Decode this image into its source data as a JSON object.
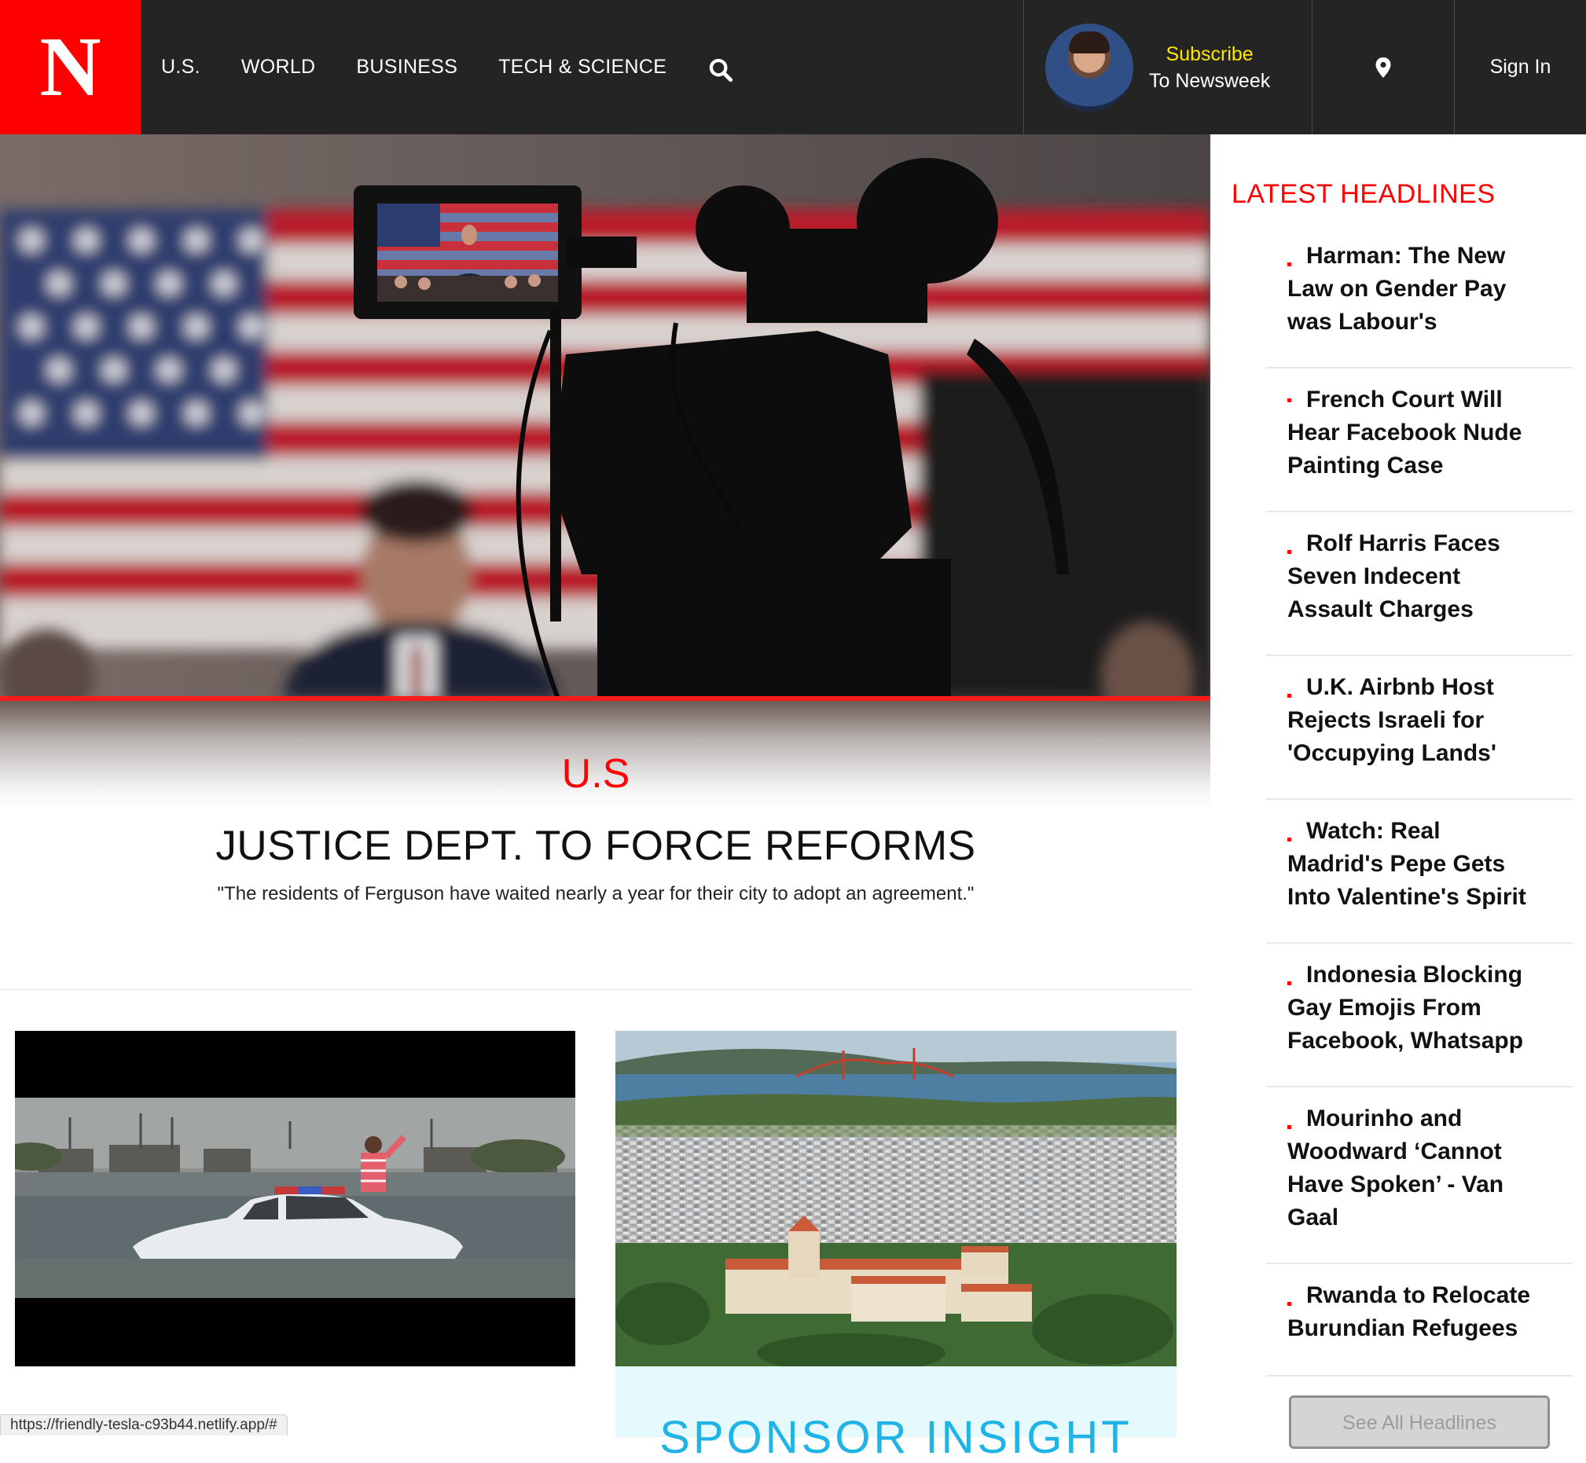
{
  "brand": {
    "logo_letter": "N",
    "red": "#ff0000",
    "nav_bg": "#242424",
    "accent_yellow": "#ffe600",
    "sponsor_blue": "#1fb3e6"
  },
  "nav": {
    "links": [
      "U.S.",
      "WORLD",
      "BUSINESS",
      "TECH & SCIENCE"
    ],
    "search_icon": "search-icon",
    "subscribe_line1": "Subscribe",
    "subscribe_line2": "To Newsweek",
    "location_icon": "map-pin-icon",
    "sign_in": "Sign In"
  },
  "hero": {
    "category": "U.S",
    "title": "JUSTICE DEPT. TO FORCE REFORMS",
    "description": "\"The residents of Ferguson have waited nearly a year for their city to adopt an agreement.\""
  },
  "cards": {
    "sponsor_label": "SPONSOR INSIGHT"
  },
  "sidebar": {
    "title": "LATEST HEADLINES",
    "headlines": [
      [
        "Harman: The New",
        "Law on Gender Pay",
        "was Labour's"
      ],
      [
        "French Court Will",
        "Hear Facebook Nude",
        "Painting Case"
      ],
      [
        "Rolf Harris Faces",
        "Seven Indecent",
        "Assault Charges"
      ],
      [
        "U.K. Airbnb Host",
        "Rejects Israeli for",
        "'Occupying Lands'"
      ],
      [
        "Watch: Real",
        "Madrid's Pepe Gets",
        "Into Valentine's Spirit"
      ],
      [
        "Indonesia Blocking",
        "Gay Emojis From",
        "Facebook, Whatsapp"
      ],
      [
        "Mourinho and",
        "Woodward ‘Cannot",
        "Have Spoken’ - Van",
        "Gaal"
      ],
      [
        "Rwanda to Relocate",
        "Burundian Refugees"
      ]
    ],
    "see_all": "See All Headlines"
  },
  "status_bar": {
    "url": "https://friendly-tesla-c93b44.netlify.app/#"
  }
}
